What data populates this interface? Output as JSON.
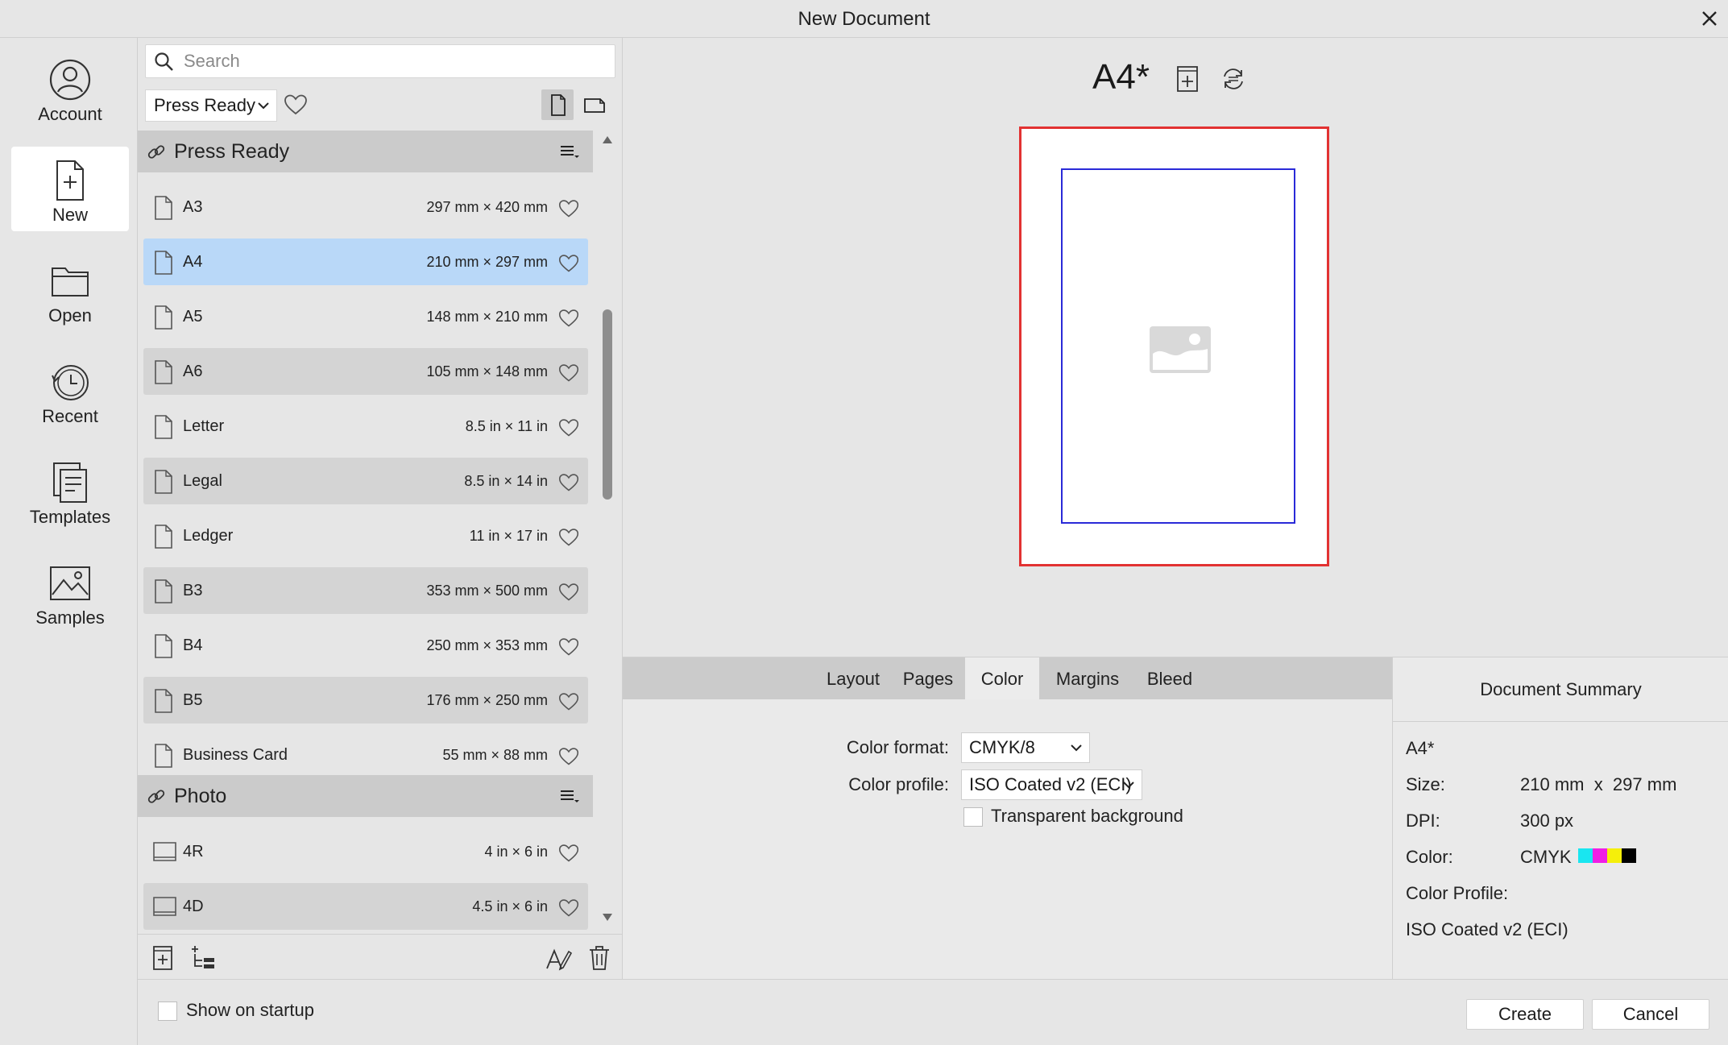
{
  "window": {
    "title": "New Document"
  },
  "nav": [
    {
      "label": "Account",
      "icon": "account-icon"
    },
    {
      "label": "New",
      "icon": "new-document-icon"
    },
    {
      "label": "Open",
      "icon": "folder-icon"
    },
    {
      "label": "Recent",
      "icon": "recent-clock-icon"
    },
    {
      "label": "Templates",
      "icon": "templates-icon"
    },
    {
      "label": "Samples",
      "icon": "samples-image-icon"
    }
  ],
  "presets": {
    "search_placeholder": "Search",
    "category": "Press Ready",
    "groups": [
      {
        "name": "Press Ready",
        "items": [
          {
            "name": "A3",
            "size": "297 mm × 420 mm"
          },
          {
            "name": "A4",
            "size": "210 mm × 297 mm",
            "selected": true
          },
          {
            "name": "A5",
            "size": "148 mm × 210 mm"
          },
          {
            "name": "A6",
            "size": "105 mm × 148 mm"
          },
          {
            "name": "Letter",
            "size": "8.5 in × 11 in"
          },
          {
            "name": "Legal",
            "size": "8.5 in × 14 in"
          },
          {
            "name": "Ledger",
            "size": "11 in × 17 in"
          },
          {
            "name": "B3",
            "size": "353 mm × 500 mm"
          },
          {
            "name": "B4",
            "size": "250 mm × 353 mm"
          },
          {
            "name": "B5",
            "size": "176 mm × 250 mm"
          },
          {
            "name": "Business Card",
            "size": "55 mm × 88 mm"
          }
        ]
      },
      {
        "name": "Photo",
        "items": [
          {
            "name": "4R",
            "size": "4 in × 6 in"
          },
          {
            "name": "4D",
            "size": "4.5 in × 6 in"
          }
        ]
      }
    ]
  },
  "preview": {
    "doc_name": "A4*"
  },
  "settings": {
    "tabs": [
      "Layout",
      "Pages",
      "Color",
      "Margins",
      "Bleed"
    ],
    "active_tab": "Color",
    "color_format_label": "Color format:",
    "color_format": "CMYK/8",
    "color_profile_label": "Color profile:",
    "color_profile": "ISO Coated v2 (ECI)",
    "transparent_label": "Transparent background"
  },
  "summary": {
    "header": "Document Summary",
    "name": "A4*",
    "size_label": "Size:",
    "size_value": "210 mm  x  297 mm",
    "dpi_label": "DPI:",
    "dpi_value": "300 px",
    "color_label": "Color:",
    "color_value": "CMYK",
    "swatches": [
      "#19e6f0",
      "#f01ee6",
      "#f5ef0a",
      "#000000"
    ],
    "profile_label": "Color Profile:",
    "profile_value": "ISO Coated v2 (ECI)"
  },
  "footer": {
    "show_on_startup": "Show on startup",
    "create": "Create",
    "cancel": "Cancel"
  },
  "colors": {
    "selection": "#b9d8f8",
    "bleed_outline": "#e23232",
    "margin_outline": "#2a2ad8"
  }
}
